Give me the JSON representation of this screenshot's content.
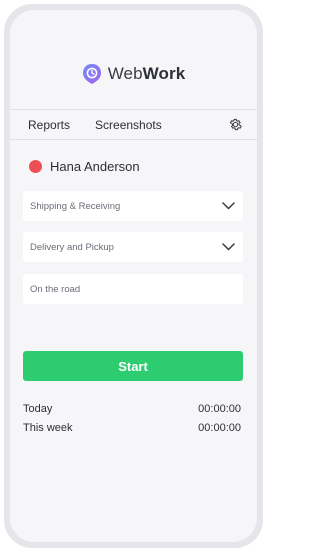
{
  "app": {
    "name_part1": "Web",
    "name_part2": "Work"
  },
  "nav": {
    "items": [
      "Reports",
      "Screenshots"
    ],
    "settings_icon": "gear-icon"
  },
  "user": {
    "name": "Hana Anderson",
    "status_color": "#ec4f55"
  },
  "fields": {
    "project": {
      "value": "Shipping & Receiving"
    },
    "task": {
      "value": "Delivery and Pickup"
    },
    "note": {
      "placeholder": "On the road"
    }
  },
  "start_button": {
    "label": "Start",
    "color": "#2ecc71"
  },
  "stats": [
    {
      "label": "Today",
      "value": "00:00:00"
    },
    {
      "label": "This week",
      "value": "00:00:00"
    }
  ],
  "colors": {
    "brand": "#7b6cf6",
    "accent_green": "#2ecc71",
    "status_red": "#ec4f55"
  }
}
